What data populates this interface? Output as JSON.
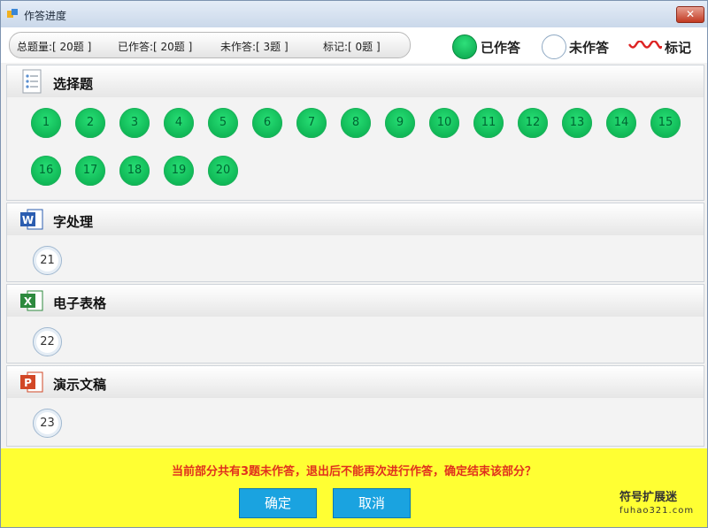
{
  "window": {
    "title": "作答进度",
    "close_label": "✕"
  },
  "summary": {
    "total": "总题量:[ 20题 ]",
    "answered": "已作答:[ 20题 ]",
    "unanswered": "未作答:[ 3题 ]",
    "marked": "标记:[ 0题 ]"
  },
  "legend": {
    "answered": "已作答",
    "unanswered": "未作答",
    "marked": "标记"
  },
  "sections": {
    "choice": {
      "title": "选择题",
      "icon": "checklist-icon",
      "answered": [
        "1",
        "2",
        "3",
        "4",
        "5",
        "6",
        "7",
        "8",
        "9",
        "10",
        "11",
        "12",
        "13",
        "14",
        "15",
        "16",
        "17",
        "18",
        "19",
        "20"
      ]
    },
    "word": {
      "title": "字处理",
      "icon": "word-icon",
      "unanswered": [
        "21"
      ]
    },
    "excel": {
      "title": "电子表格",
      "icon": "excel-icon",
      "unanswered": [
        "22"
      ]
    },
    "ppt": {
      "title": "演示文稿",
      "icon": "powerpoint-icon",
      "unanswered": [
        "23"
      ]
    }
  },
  "footer": {
    "message": "当前部分共有3题未作答，退出后不能再次进行作答，确定结束该部分？",
    "confirm": "确定",
    "cancel": "取消"
  },
  "watermark": {
    "line1": "符号扩展迷",
    "line2": "fuhao321.com"
  },
  "colors": {
    "answered": "#0bb554",
    "footer_bg": "#ffff33",
    "message": "#e0301e",
    "button": "#1aa3e0"
  }
}
